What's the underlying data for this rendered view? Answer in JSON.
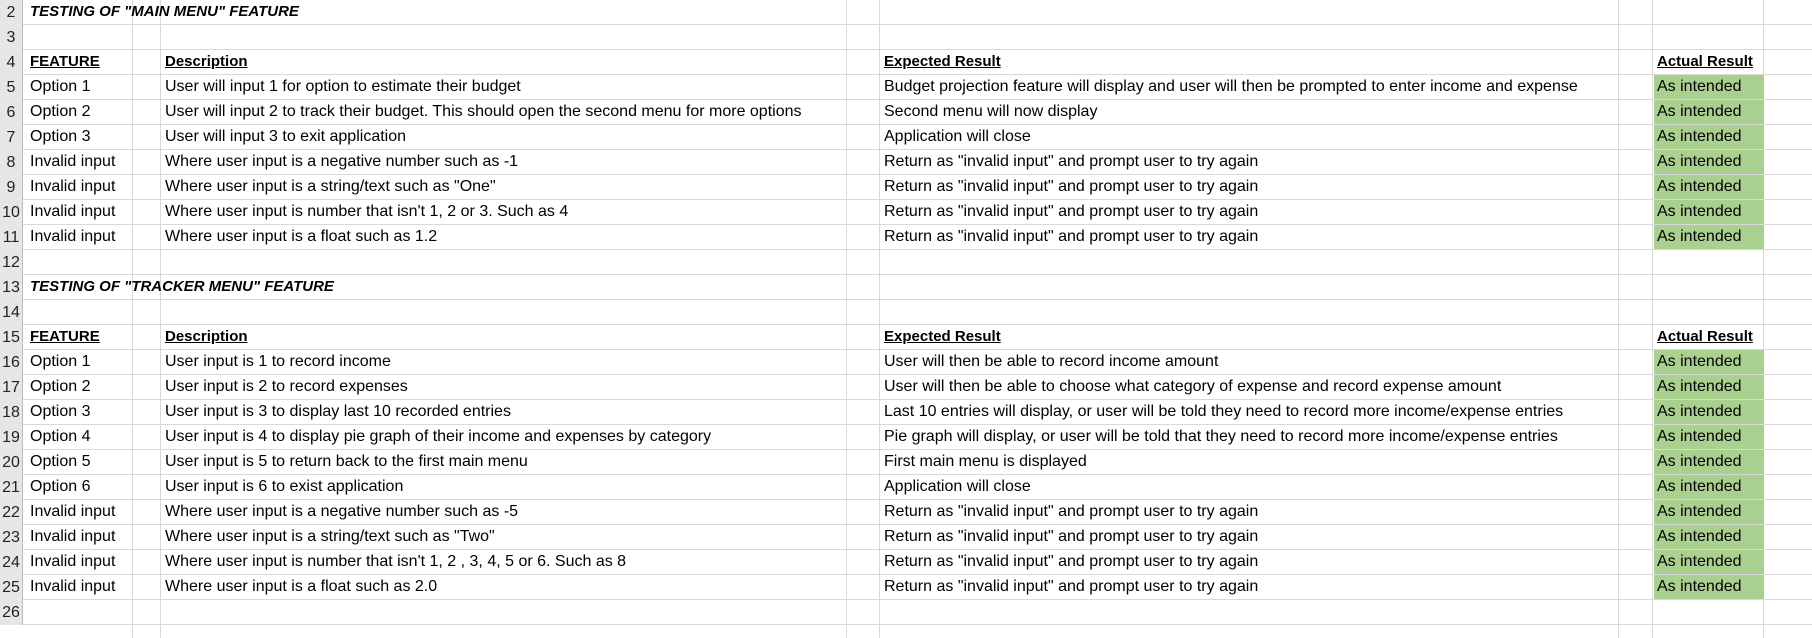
{
  "sections": [
    {
      "title_row": "2",
      "title": "TESTING OF \"MAIN MENU\" FEATURE",
      "blank_row": "3",
      "header_row": "4",
      "headers": {
        "feature": "FEATURE",
        "description": "Description",
        "expected": "Expected Result",
        "actual": "Actual Result"
      },
      "rows": [
        {
          "num": "5",
          "feature": "Option 1",
          "description": "User will input 1 for option to estimate their budget",
          "expected": "Budget projection feature will display and user will then be prompted to enter income and expense",
          "actual": "As intended"
        },
        {
          "num": "6",
          "feature": "Option 2",
          "description": "User will input 2 to track their budget. This should open the second menu for more options",
          "expected": "Second menu will now display",
          "actual": "As intended"
        },
        {
          "num": "7",
          "feature": "Option 3",
          "description": "User will input 3 to exit application",
          "expected": "Application will close",
          "actual": "As intended"
        },
        {
          "num": "8",
          "feature": "Invalid input",
          "description": "Where user input is a negative number such as -1",
          "expected": "Return as \"invalid input\" and prompt user to try again",
          "actual": "As intended"
        },
        {
          "num": "9",
          "feature": "Invalid input",
          "description": "Where user input is a string/text such as \"One\"",
          "expected": "Return as \"invalid input\" and prompt user to try again",
          "actual": "As intended"
        },
        {
          "num": "10",
          "feature": "Invalid input",
          "description": "Where user input is number that isn't 1, 2 or 3. Such as 4",
          "expected": "Return as \"invalid input\" and prompt user to try again",
          "actual": "As intended"
        },
        {
          "num": "11",
          "feature": "Invalid input",
          "description": "Where user input is a float such as 1.2",
          "expected": "Return as \"invalid input\" and prompt user to try again",
          "actual": "As intended"
        }
      ],
      "trailing_blank_row": "12"
    },
    {
      "title_row": "13",
      "title": "TESTING OF \"TRACKER MENU\" FEATURE",
      "blank_row": "14",
      "header_row": "15",
      "headers": {
        "feature": "FEATURE",
        "description": "Description",
        "expected": "Expected Result",
        "actual": "Actual Result"
      },
      "rows": [
        {
          "num": "16",
          "feature": "Option 1",
          "description": "User input is 1 to record income",
          "expected": "User will then be able to record income amount",
          "actual": "As intended"
        },
        {
          "num": "17",
          "feature": "Option 2",
          "description": "User input is 2 to record expenses",
          "expected": "User will then be able to choose what category of expense and record expense amount",
          "actual": "As intended"
        },
        {
          "num": "18",
          "feature": "Option 3",
          "description": "User input is 3 to display last 10 recorded entries",
          "expected": "Last 10 entries will display, or user will be told they need to record more income/expense entries",
          "actual": "As intended"
        },
        {
          "num": "19",
          "feature": "Option 4",
          "description": "User input is 4 to display pie graph of their income and expenses by category",
          "expected": "Pie graph will display, or user will be told that they need to record more income/expense entries",
          "actual": "As intended"
        },
        {
          "num": "20",
          "feature": "Option 5",
          "description": "User input is 5 to return back to the first main menu",
          "expected": "First main menu is displayed",
          "actual": "As intended"
        },
        {
          "num": "21",
          "feature": "Option 6",
          "description": "User input is 6 to exist application",
          "expected": "Application will close",
          "actual": "As intended"
        },
        {
          "num": "22",
          "feature": "Invalid input",
          "description": "Where user input is a negative number such as -5",
          "expected": "Return as \"invalid input\" and prompt user to try again",
          "actual": "As intended"
        },
        {
          "num": "23",
          "feature": "Invalid input",
          "description": "Where user input is a string/text such as \"Two\"",
          "expected": "Return as \"invalid input\" and prompt user to try again",
          "actual": "As intended"
        },
        {
          "num": "24",
          "feature": "Invalid input",
          "description": "Where user input is number that isn't 1, 2 , 3, 4, 5 or 6.  Such as 8",
          "expected": "Return as \"invalid input\" and prompt user to try again",
          "actual": "As intended"
        },
        {
          "num": "25",
          "feature": "Invalid input",
          "description": "Where user input is a float such as 2.0",
          "expected": "Return as \"invalid input\" and prompt user to try again",
          "actual": "As intended"
        }
      ],
      "trailing_blank_row": "26"
    }
  ],
  "colors": {
    "result_fill": "#a9d08e",
    "row_header_fill": "#e6e6e6",
    "gridline": "#d9d9d9"
  }
}
